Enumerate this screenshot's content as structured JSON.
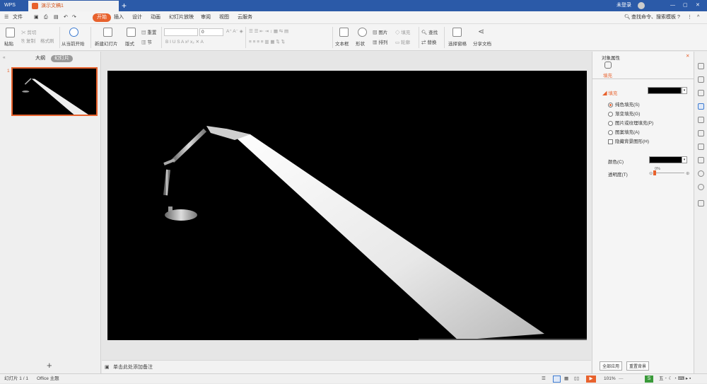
{
  "titlebar": {
    "app": "WPS",
    "doc_tab": "演示文稿1",
    "add": "+",
    "login": "未登录"
  },
  "menu": {
    "items": [
      "开始",
      "插入",
      "设计",
      "动画",
      "幻灯片放映",
      "审阅",
      "视图",
      "云服务"
    ],
    "file": "文件",
    "search": "查找命令、搜索模板",
    "help": "?"
  },
  "ribbon": {
    "paste": "粘贴",
    "cut": "剪切",
    "copy": "复制",
    "format_painter": "格式刷",
    "from_start": "从当前开始",
    "new_slide": "新建幻灯片",
    "layout": "版式",
    "reset": "重置",
    "section": "节",
    "font_size": "0",
    "text_box": "文本框",
    "shape": "形状",
    "picture": "图片",
    "fill": "填充",
    "arrange": "排列",
    "outline": "轮廓",
    "find": "查找",
    "replace": "替换",
    "select_pane": "选择窗格",
    "share": "分享文档"
  },
  "left_panel": {
    "tab_outline": "大纲",
    "tab_slides": "幻灯片",
    "slide_number": "1",
    "add": "+"
  },
  "notes": {
    "placeholder": "单击此处添加备注"
  },
  "right_panel": {
    "title": "对象属性",
    "tab_fill": "填充",
    "section_fill": "填充",
    "options": [
      "纯色填充(S)",
      "渐变填充(G)",
      "图片或纹理填充(P)",
      "图案填充(A)"
    ],
    "hide_bg": "隐藏背景图形(H)",
    "color_label": "颜色(C)",
    "transparency_label": "透明度(T)",
    "transparency_value": "0%",
    "apply_all": "全部应用",
    "reset_bg": "重置背景"
  },
  "status": {
    "slide_info": "幻灯片 1 / 1",
    "theme": "Office 主题",
    "zoom": "101%"
  }
}
